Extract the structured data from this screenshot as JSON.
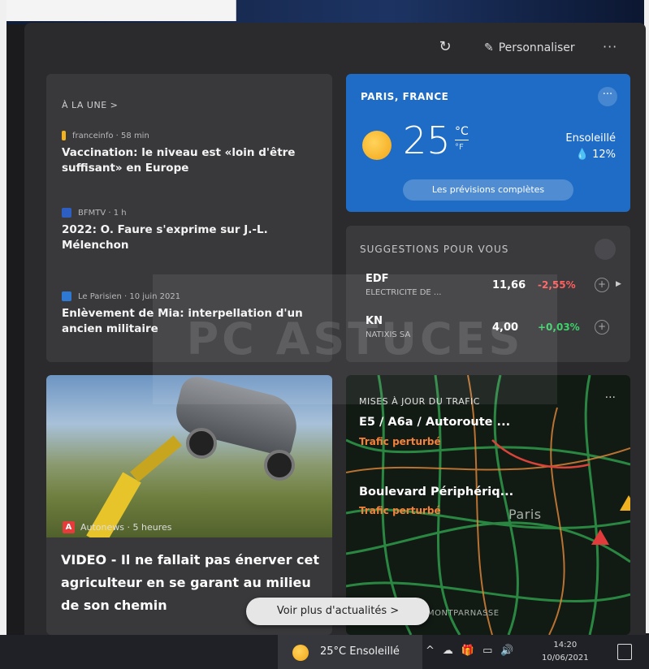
{
  "topbar": {
    "personalize_label": "Personnaliser",
    "more_label": "···"
  },
  "news": {
    "section_label": "À LA UNE >",
    "items": [
      {
        "source": "franceinfo · 58 min",
        "headline": "Vaccination: le niveau est «loin d'être suffisant» en Europe",
        "icon_color": "#f2b120"
      },
      {
        "source": "BFMTV · 1 h",
        "headline": "2022: O. Faure s'exprime sur J.-L. Mélenchon",
        "icon_color": "#2d5fc2"
      },
      {
        "source": "Le Parisien · 10 juin 2021",
        "headline": "Enlèvement de Mia: interpellation d'un ancien militaire",
        "icon_color": "#2d79d4"
      }
    ]
  },
  "weather": {
    "location": "PARIS, FRANCE",
    "temperature": "25",
    "unit_c": "°C",
    "unit_f": "°F",
    "condition": "Ensoleillé",
    "precip": "💧 12%",
    "forecast_button": "Les prévisions complètes",
    "more": "···"
  },
  "stocks": {
    "title": "SUGGESTIONS POUR VOUS",
    "rows": [
      {
        "symbol": "EDF",
        "name": "ELECTRICITE DE ...",
        "value": "11,66",
        "change": "-2,55%",
        "change_color": "#ff5f5f"
      },
      {
        "symbol": "KN",
        "name": "NATIXIS SA",
        "value": "4,00",
        "change": "+0,03%",
        "change_color": "#3fd16c"
      }
    ]
  },
  "photo_story": {
    "source": "Autonews · 5 heures",
    "source_badge": "A",
    "headline": "VIDEO - Il ne fallait pas énerver cet agriculteur en se garant au milieu de son chemin"
  },
  "traffic": {
    "title": "MISES À JOUR DU TRAFIC",
    "more": "···",
    "routes": [
      {
        "road": "E5 / A6a / Autoroute ...",
        "status": "Trafic perturbé"
      },
      {
        "road": "Boulevard Périphériq...",
        "status": "Trafic perturbé"
      }
    ],
    "map_labels": [
      "Paris",
      "MONTPARNASSE"
    ]
  },
  "more_news_button": "Voir plus d'actualités  >",
  "taskbar": {
    "weather_text": "25°C  Ensoleillé",
    "time": "14:20",
    "date": "10/06/2021"
  }
}
